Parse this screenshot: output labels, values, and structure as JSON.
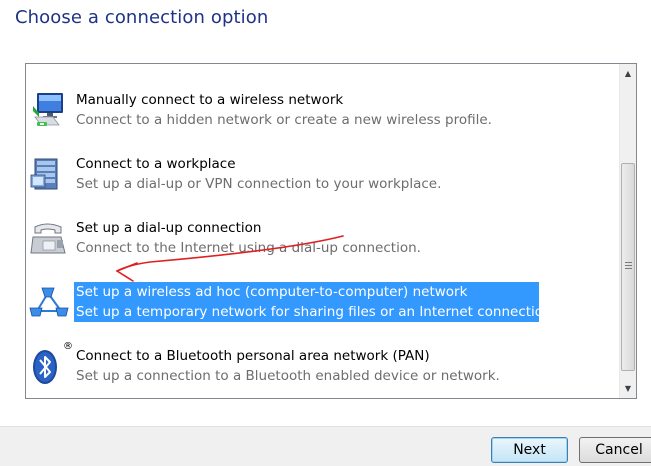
{
  "window": {
    "title": "Choose a connection option"
  },
  "options": [
    {
      "title": "Manually connect to a wireless network",
      "description": "Connect to a hidden network or create a new wireless profile.",
      "icon": "wireless-network-icon"
    },
    {
      "title": "Connect to a workplace",
      "description": "Set up a dial-up or VPN connection to your workplace.",
      "icon": "workplace-server-icon"
    },
    {
      "title": "Set up a dial-up connection",
      "description": "Connect to the Internet using a dial-up connection.",
      "icon": "telephone-icon"
    },
    {
      "title": "Set up a wireless ad hoc (computer-to-computer) network",
      "description": "Set up a temporary network for sharing files or an Internet connection.",
      "icon": "adhoc-network-icon",
      "selected": true
    },
    {
      "title": "Connect to a Bluetooth personal area network (PAN)",
      "description": "Set up a connection to a Bluetooth enabled device or network.",
      "icon": "bluetooth-icon",
      "badge": "®"
    }
  ],
  "buttons": {
    "next": "Next",
    "cancel": "Cancel"
  },
  "colors": {
    "selection": "#3399ff",
    "title": "#1e3287",
    "annotation_arrow": "#e02020"
  }
}
